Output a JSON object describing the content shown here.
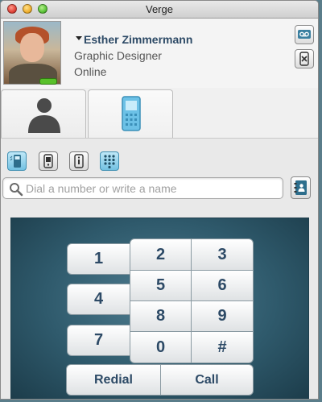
{
  "window": {
    "title": "Verge"
  },
  "profile": {
    "name": "Esther Zimmermann",
    "role": "Graphic Designer",
    "status": "Online",
    "status_color": "#58c02a"
  },
  "buttons": {
    "voicemail_icon": "voicemail-icon",
    "hangup_icon": "phone-off-icon"
  },
  "tabs": [
    {
      "id": "contacts",
      "icon": "person-icon",
      "selected": false
    },
    {
      "id": "phone",
      "icon": "mobile-phone-icon",
      "selected": true
    }
  ],
  "modes": [
    {
      "id": "dialer",
      "icon": "phone-dial-icon",
      "active": true
    },
    {
      "id": "cell",
      "icon": "cellphone-icon",
      "active": false
    },
    {
      "id": "device",
      "icon": "device-info-icon",
      "active": false
    },
    {
      "id": "keypad",
      "icon": "keypad-grid-icon",
      "active": true
    }
  ],
  "search": {
    "placeholder": "Dial a number or write a name",
    "value": ""
  },
  "keypad": {
    "k1": "1",
    "k2": "2",
    "k3": "3",
    "k4": "4",
    "k5": "5",
    "k6": "6",
    "k7": "7",
    "k8": "8",
    "k9": "9",
    "k0": "0",
    "khash": "#",
    "redial": "Redial",
    "call": "Call"
  },
  "colors": {
    "accent_text": "#2d4a66",
    "panel_dark": "#2f5a6c",
    "mode_active": "#73c1e2"
  }
}
